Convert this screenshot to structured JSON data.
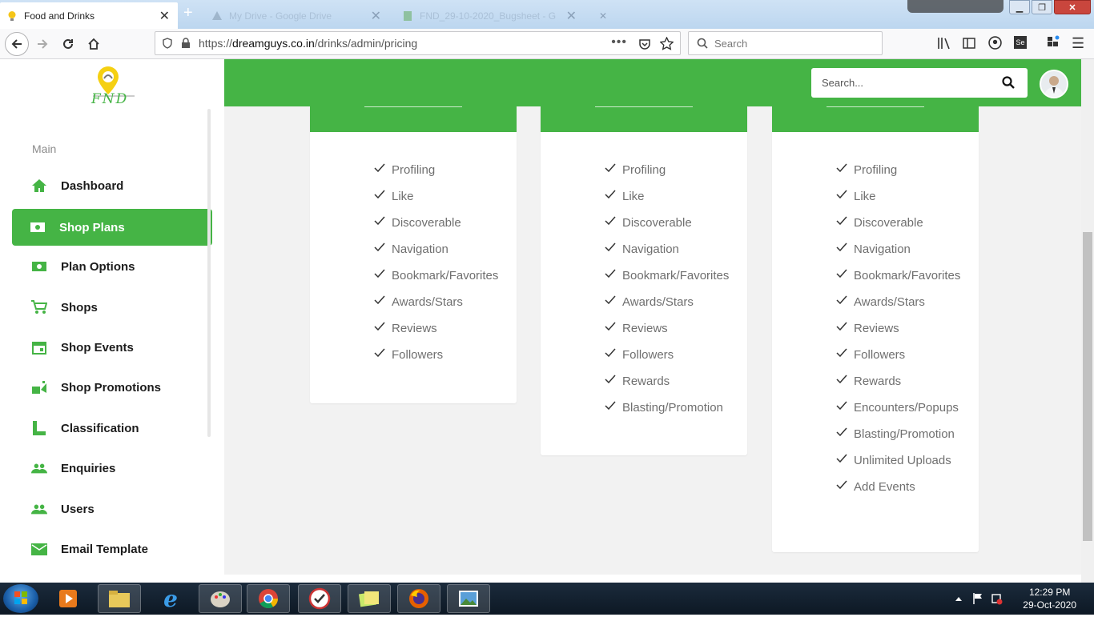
{
  "browser": {
    "tabs": [
      {
        "label": "Food and Drinks",
        "active": true
      },
      {
        "label": "My Drive - Google Drive",
        "active": false
      },
      {
        "label": "FND_29-10-2020_Bugsheet - G",
        "active": false
      }
    ],
    "url_prefix": "https://",
    "url_domain": "dreamguys.co.in",
    "url_path": "/drinks/admin/pricing",
    "search_placeholder": "Search"
  },
  "app": {
    "logo_text": "FND",
    "search_placeholder": "Search...",
    "accent": "#45b445"
  },
  "sidebar": {
    "section": "Main",
    "items": [
      {
        "label": "Dashboard",
        "icon": "home-icon",
        "active": false
      },
      {
        "label": "Shop Plans",
        "icon": "money-icon",
        "active": true
      },
      {
        "label": "Plan Options",
        "icon": "money-icon",
        "active": false
      },
      {
        "label": "Shops",
        "icon": "cart-icon",
        "active": false
      },
      {
        "label": "Shop Events",
        "icon": "calendar-icon",
        "active": false
      },
      {
        "label": "Shop Promotions",
        "icon": "promotion-icon",
        "active": false
      },
      {
        "label": "Classification",
        "icon": "classification-icon",
        "active": false
      },
      {
        "label": "Enquiries",
        "icon": "people-icon",
        "active": false
      },
      {
        "label": "Users",
        "icon": "people-icon",
        "active": false
      },
      {
        "label": "Email Template",
        "icon": "mail-icon",
        "active": false
      }
    ]
  },
  "plans": [
    {
      "features": [
        "Profiling",
        "Like",
        "Discoverable",
        "Navigation",
        "Bookmark/Favorites",
        "Awards/Stars",
        "Reviews",
        "Followers"
      ]
    },
    {
      "features": [
        "Profiling",
        "Like",
        "Discoverable",
        "Navigation",
        "Bookmark/Favorites",
        "Awards/Stars",
        "Reviews",
        "Followers",
        "Rewards",
        "Blasting/Promotion"
      ]
    },
    {
      "features": [
        "Profiling",
        "Like",
        "Discoverable",
        "Navigation",
        "Bookmark/Favorites",
        "Awards/Stars",
        "Reviews",
        "Followers",
        "Rewards",
        "Encounters/Popups",
        "Blasting/Promotion",
        "Unlimited Uploads",
        "Add Events"
      ]
    }
  ],
  "taskbar": {
    "time": "12:29 PM",
    "date": "29-Oct-2020"
  }
}
